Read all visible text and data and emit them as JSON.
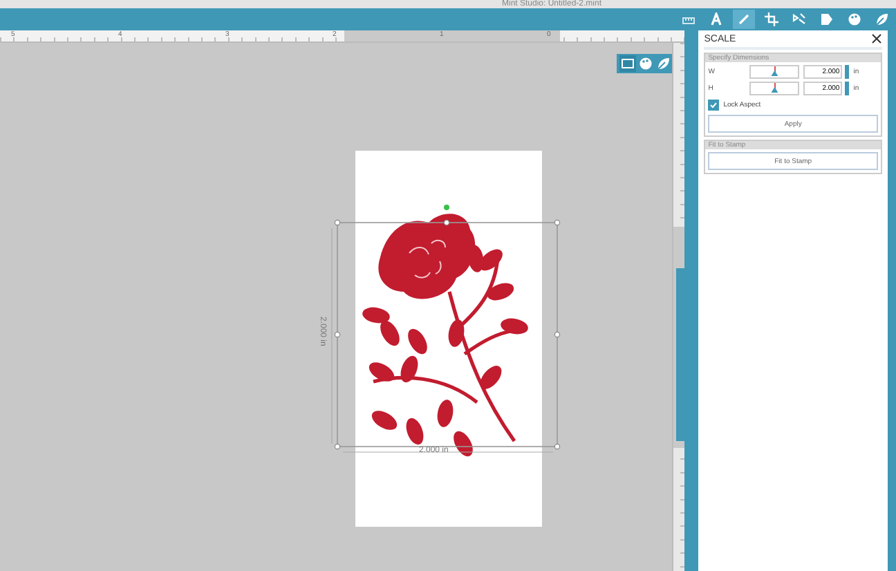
{
  "window": {
    "title": "Mint Studio: Untitled-2.mint"
  },
  "toolbar_tools": [
    {
      "kind": "ruler",
      "selected": false
    },
    {
      "kind": "text",
      "selected": false
    },
    {
      "kind": "pen",
      "selected": true
    },
    {
      "kind": "crop",
      "selected": false
    },
    {
      "kind": "transform",
      "selected": false
    },
    {
      "kind": "stamp",
      "selected": false
    },
    {
      "kind": "palette",
      "selected": false
    },
    {
      "kind": "leaf",
      "selected": false
    }
  ],
  "ruler": {
    "labels": [
      "5",
      "4",
      "3",
      "2",
      "1",
      "0"
    ]
  },
  "view_toggles": [
    {
      "kind": "page",
      "selected": true
    },
    {
      "kind": "palette",
      "selected": false
    },
    {
      "kind": "leaf",
      "selected": false
    }
  ],
  "canvas": {
    "width_label": "2.000 in",
    "height_label": "2.000 in"
  },
  "panel": {
    "title": "SCALE",
    "sections": [
      {
        "title": "Specify Dimensions",
        "fields": [
          {
            "label": "W",
            "value": "2.000",
            "unit": "in",
            "level": 0.5
          },
          {
            "label": "H",
            "value": "2.000",
            "unit": "in",
            "level": 0.5
          }
        ],
        "lock_aspect": {
          "label": "Lock Aspect",
          "checked": true
        },
        "button": "Apply"
      },
      {
        "title": "Fit to Stamp",
        "button": "Fit to Stamp"
      }
    ]
  }
}
